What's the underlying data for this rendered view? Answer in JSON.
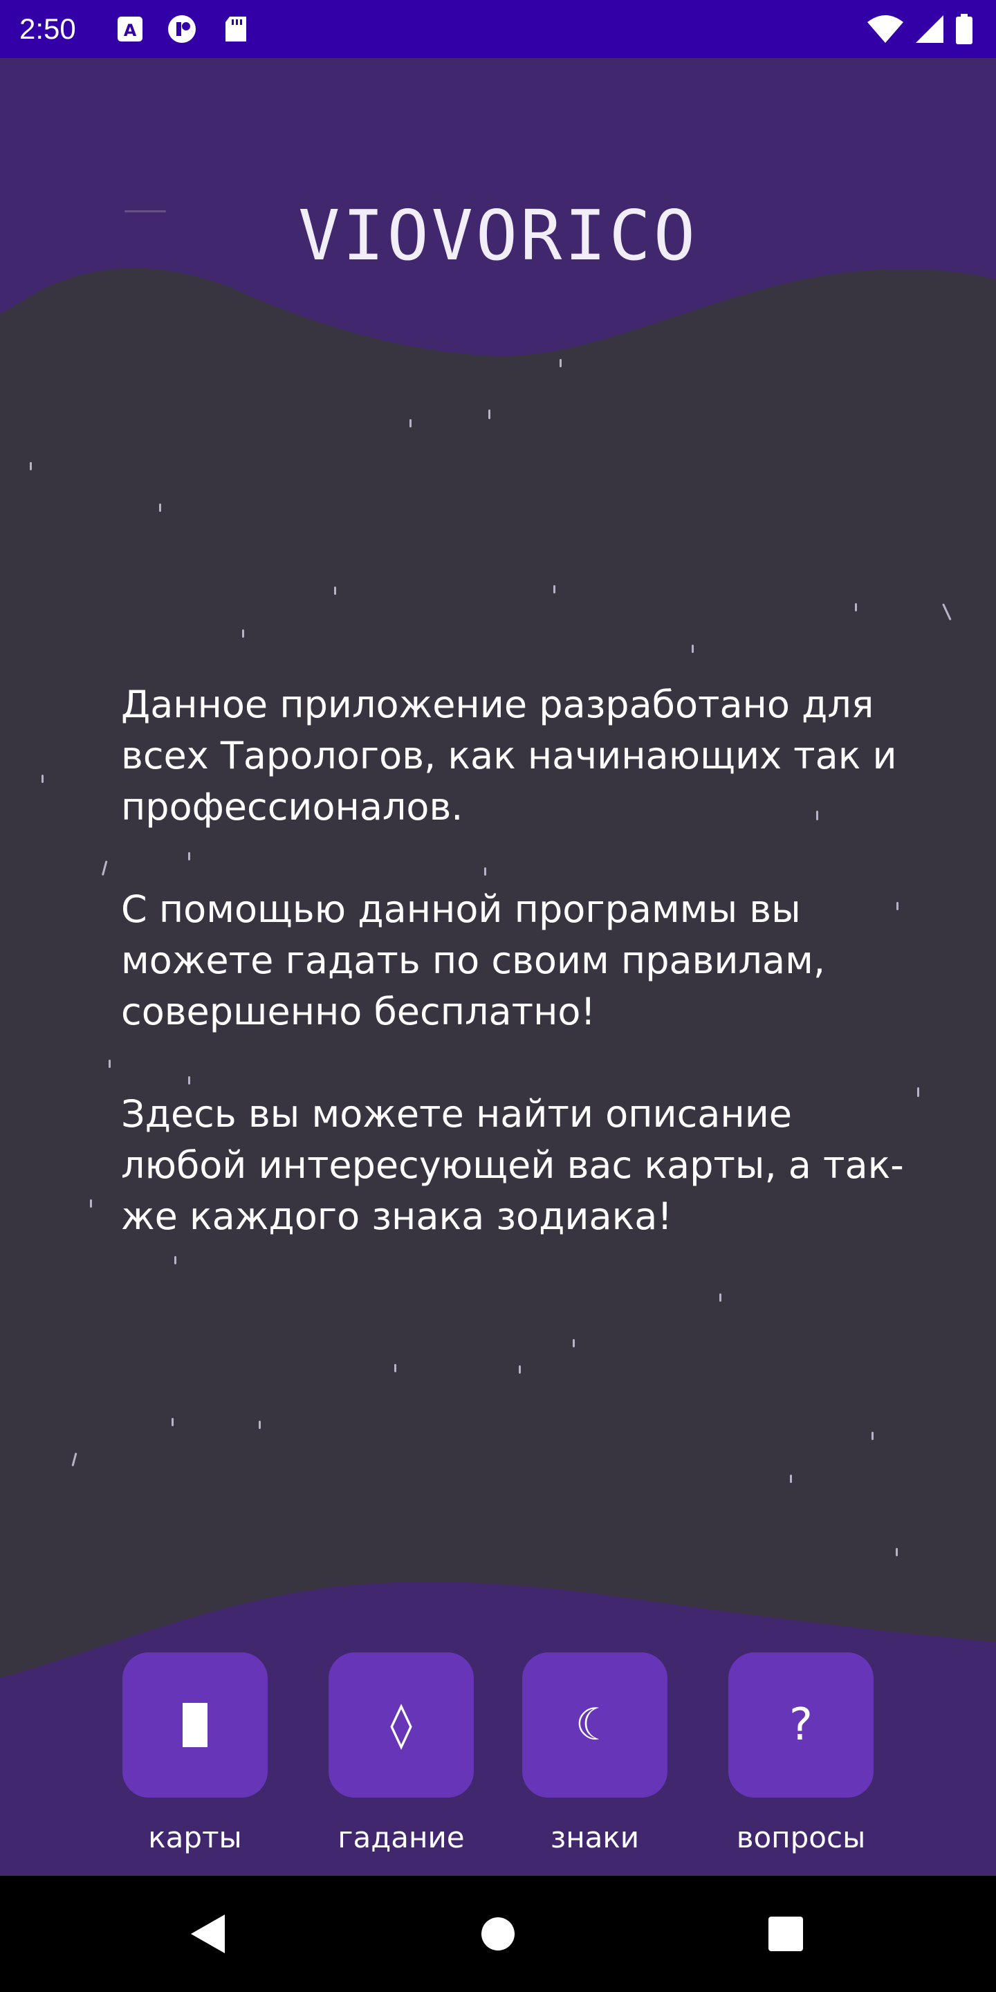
{
  "status_bar": {
    "time": "2:50",
    "icons": [
      "a-notification-icon",
      "refresh-notification-icon",
      "sd-card-icon",
      "wifi-icon",
      "cell-signal-icon",
      "battery-icon"
    ]
  },
  "app": {
    "title": "VIOVORICO"
  },
  "intro": {
    "paragraphs": [
      "Данное приложение разработано для всех Тарологов, как начинающих так и профессионалов.",
      "С помощью данной программы вы можете гадать по своим правилам, совершенно бесплатно!",
      "Здесь вы можете найти описание любой интересующей вас карты, а так-же каждого знака зодиака!"
    ]
  },
  "nav": {
    "items": [
      {
        "label": "карты",
        "icon": "card-icon",
        "glyph": ""
      },
      {
        "label": "гадание",
        "icon": "diamond-icon",
        "glyph": "◊"
      },
      {
        "label": "знаки",
        "icon": "moon-icon",
        "glyph": "☾"
      },
      {
        "label": "вопросы",
        "icon": "question-icon",
        "glyph": "?"
      }
    ]
  },
  "colors": {
    "status_bar": "#3300a8",
    "header_purple": "#41276e",
    "background": "#383541",
    "tile": "#6736b8",
    "text": "#ffffff"
  }
}
